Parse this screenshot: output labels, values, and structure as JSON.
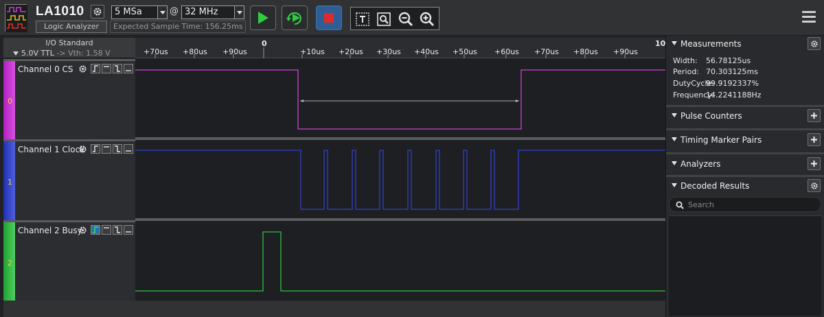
{
  "toolbar": {
    "app_name": "LA1010",
    "app_subtitle": "Logic Analyzer",
    "sample_depth": "5 MSa",
    "at_symbol": "@",
    "sample_rate": "32 MHz",
    "expected_time": "Expected Sample Time: 156.25ms"
  },
  "io": {
    "title": "I/O Standard",
    "level": "5.0V TTL",
    "arrow": "->",
    "vth": "Vth: 1.58 V"
  },
  "timeline": {
    "left_ticks": [
      "+70us",
      "+80us",
      "+90us"
    ],
    "zero": "0",
    "right_ticks": [
      "+10us",
      "+20us",
      "+30us",
      "+40us",
      "+50us",
      "+60us",
      "+70us",
      "+80us",
      "+90us"
    ],
    "cut_label": "10("
  },
  "channels": [
    {
      "name": "Channel 0 CS",
      "number": "0",
      "color": "#d040d8",
      "trigger": "none"
    },
    {
      "name": "Channel 1 Clock",
      "number": "1",
      "color": "#3040c8",
      "trigger": "none"
    },
    {
      "name": "Channel 2 Busy",
      "number": "2",
      "color": "#30c040",
      "trigger": "rising"
    }
  ],
  "panel": {
    "measurements": {
      "title": "Measurements",
      "rows": [
        {
          "label": "Width:",
          "value": "56.78125us"
        },
        {
          "label": "Period:",
          "value": "70.303125ms"
        },
        {
          "label": "DutyCycle:",
          "value": "99.9192337%"
        },
        {
          "label": "Frequency:",
          "value": "14.2241188Hz"
        }
      ]
    },
    "pulse_counters": "Pulse Counters",
    "timing_marker_pairs": "Timing Marker Pairs",
    "analyzers": "Analyzers",
    "decoded_results": "Decoded Results",
    "search_placeholder": "Search"
  },
  "colors": {
    "run_green": "#2ecc40",
    "stop_red": "#e02a2a",
    "stop_bg": "#2e5e93"
  }
}
